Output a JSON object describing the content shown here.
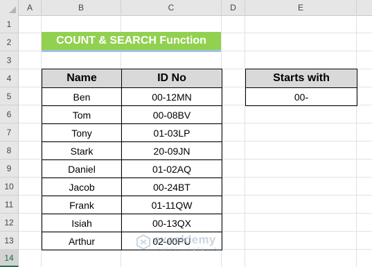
{
  "columns": [
    "A",
    "B",
    "C",
    "D",
    "E"
  ],
  "rows": [
    "1",
    "2",
    "3",
    "4",
    "5",
    "6",
    "7",
    "8",
    "9",
    "10",
    "11",
    "12",
    "13",
    "14"
  ],
  "title": "COUNT & SEARCH Function",
  "table": {
    "headers": [
      "Name",
      "ID No"
    ],
    "rows": [
      [
        "Ben",
        "00-12MN"
      ],
      [
        "Tom",
        "00-08BV"
      ],
      [
        "Tony",
        "01-03LP"
      ],
      [
        "Stark",
        "20-09JN"
      ],
      [
        "Daniel",
        "01-02AQ"
      ],
      [
        "Jacob",
        "00-24BT"
      ],
      [
        "Frank",
        "01-11QW"
      ],
      [
        "Isiah",
        "00-13QX"
      ],
      [
        "Arthur",
        "02-00PU"
      ]
    ]
  },
  "criteria": {
    "header": "Starts with",
    "value": "00-"
  },
  "watermark": {
    "name": "exceldemy",
    "tagline": "EXCEL · DATA · BI"
  },
  "colors": {
    "title_bg": "#92d050",
    "header_bg": "#d9d9d9",
    "active_row": "#217346"
  }
}
